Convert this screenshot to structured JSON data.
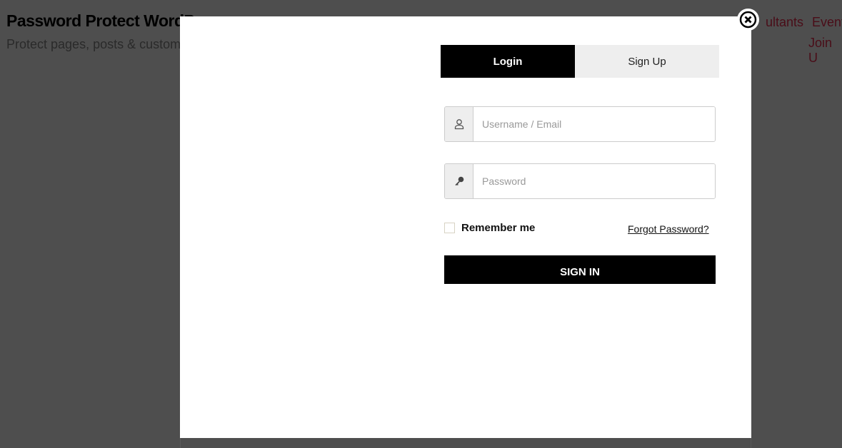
{
  "site": {
    "title": "Password Protect WordP",
    "subtitle": "Protect pages, posts & custom",
    "nav": [
      "ultants",
      "Event",
      "Join U"
    ]
  },
  "modal": {
    "tabs": [
      {
        "label": "Login",
        "active": true
      },
      {
        "label": "Sign Up",
        "active": false
      }
    ],
    "username": {
      "placeholder": "Username / Email",
      "value": "",
      "icon": "user-icon"
    },
    "password": {
      "placeholder": "Password",
      "value": "",
      "icon": "key-icon"
    },
    "remember_label": "Remember me",
    "remember_checked": false,
    "forgot_label": "Forgot Password?",
    "submit_label": "SIGN IN",
    "close_icon": "close-circle-icon"
  }
}
